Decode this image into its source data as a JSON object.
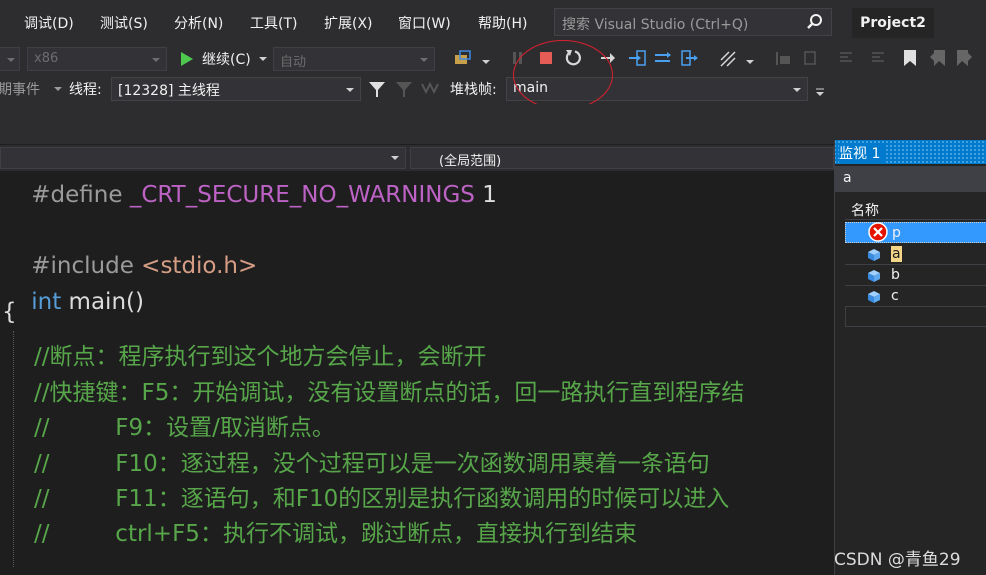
{
  "menu": {
    "items": [
      "调试(D)",
      "测试(S)",
      "分析(N)",
      "工具(T)",
      "扩展(X)",
      "窗口(W)",
      "帮助(H)"
    ],
    "search_placeholder": "搜索 Visual Studio (Ctrl+Q)",
    "project_name": "Project2"
  },
  "toolbar": {
    "platform": "x86",
    "continue_label": "继续(C)",
    "auto_label": "自动",
    "events_label": "期事件",
    "thread_label": "线程:",
    "thread_value": "[12328] 主线程",
    "stackframe_label": "堆栈帧:",
    "stackframe_value": "main"
  },
  "navbar": {
    "scope": "(全局范围)"
  },
  "editor": {
    "line1_directive": "#define ",
    "line1_macro": "_CRT_SECURE_NO_WARNINGS",
    "line1_value": " 1",
    "line3_directive": "#include ",
    "line3_header": "<stdio.h>",
    "line4_kw": "int",
    "line4_rest": " main()",
    "line5": "{",
    "comments": [
      "//断点：程序执行到这个地方会停止，会断开",
      "//快捷键：F5：开始调试，没有设置断点的话，回一路执行直到程序结",
      "//         F9：设置/取消断点。",
      "//         F10：逐过程，没个过程可以是一次函数调用裹着一条语句",
      "//         F11：逐语句，和F10的区别是执行函数调用的时候可以进入",
      "//         ctrl+F5：执行不调试，跳过断点，直接执行到结束"
    ]
  },
  "watch": {
    "title": "监视 1",
    "search_value": "a",
    "column_name": "名称",
    "rows": [
      {
        "name": "p",
        "icon": "error-icon"
      },
      {
        "name": "a",
        "icon": "variable-icon"
      },
      {
        "name": "b",
        "icon": "variable-icon"
      },
      {
        "name": "c",
        "icon": "variable-icon"
      }
    ]
  },
  "watermark": "CSDN @青鱼29",
  "colors": {
    "accent": "#007acc",
    "stop_red": "#e51400",
    "play_green": "#4ec94e",
    "comment": "#57a64a"
  }
}
